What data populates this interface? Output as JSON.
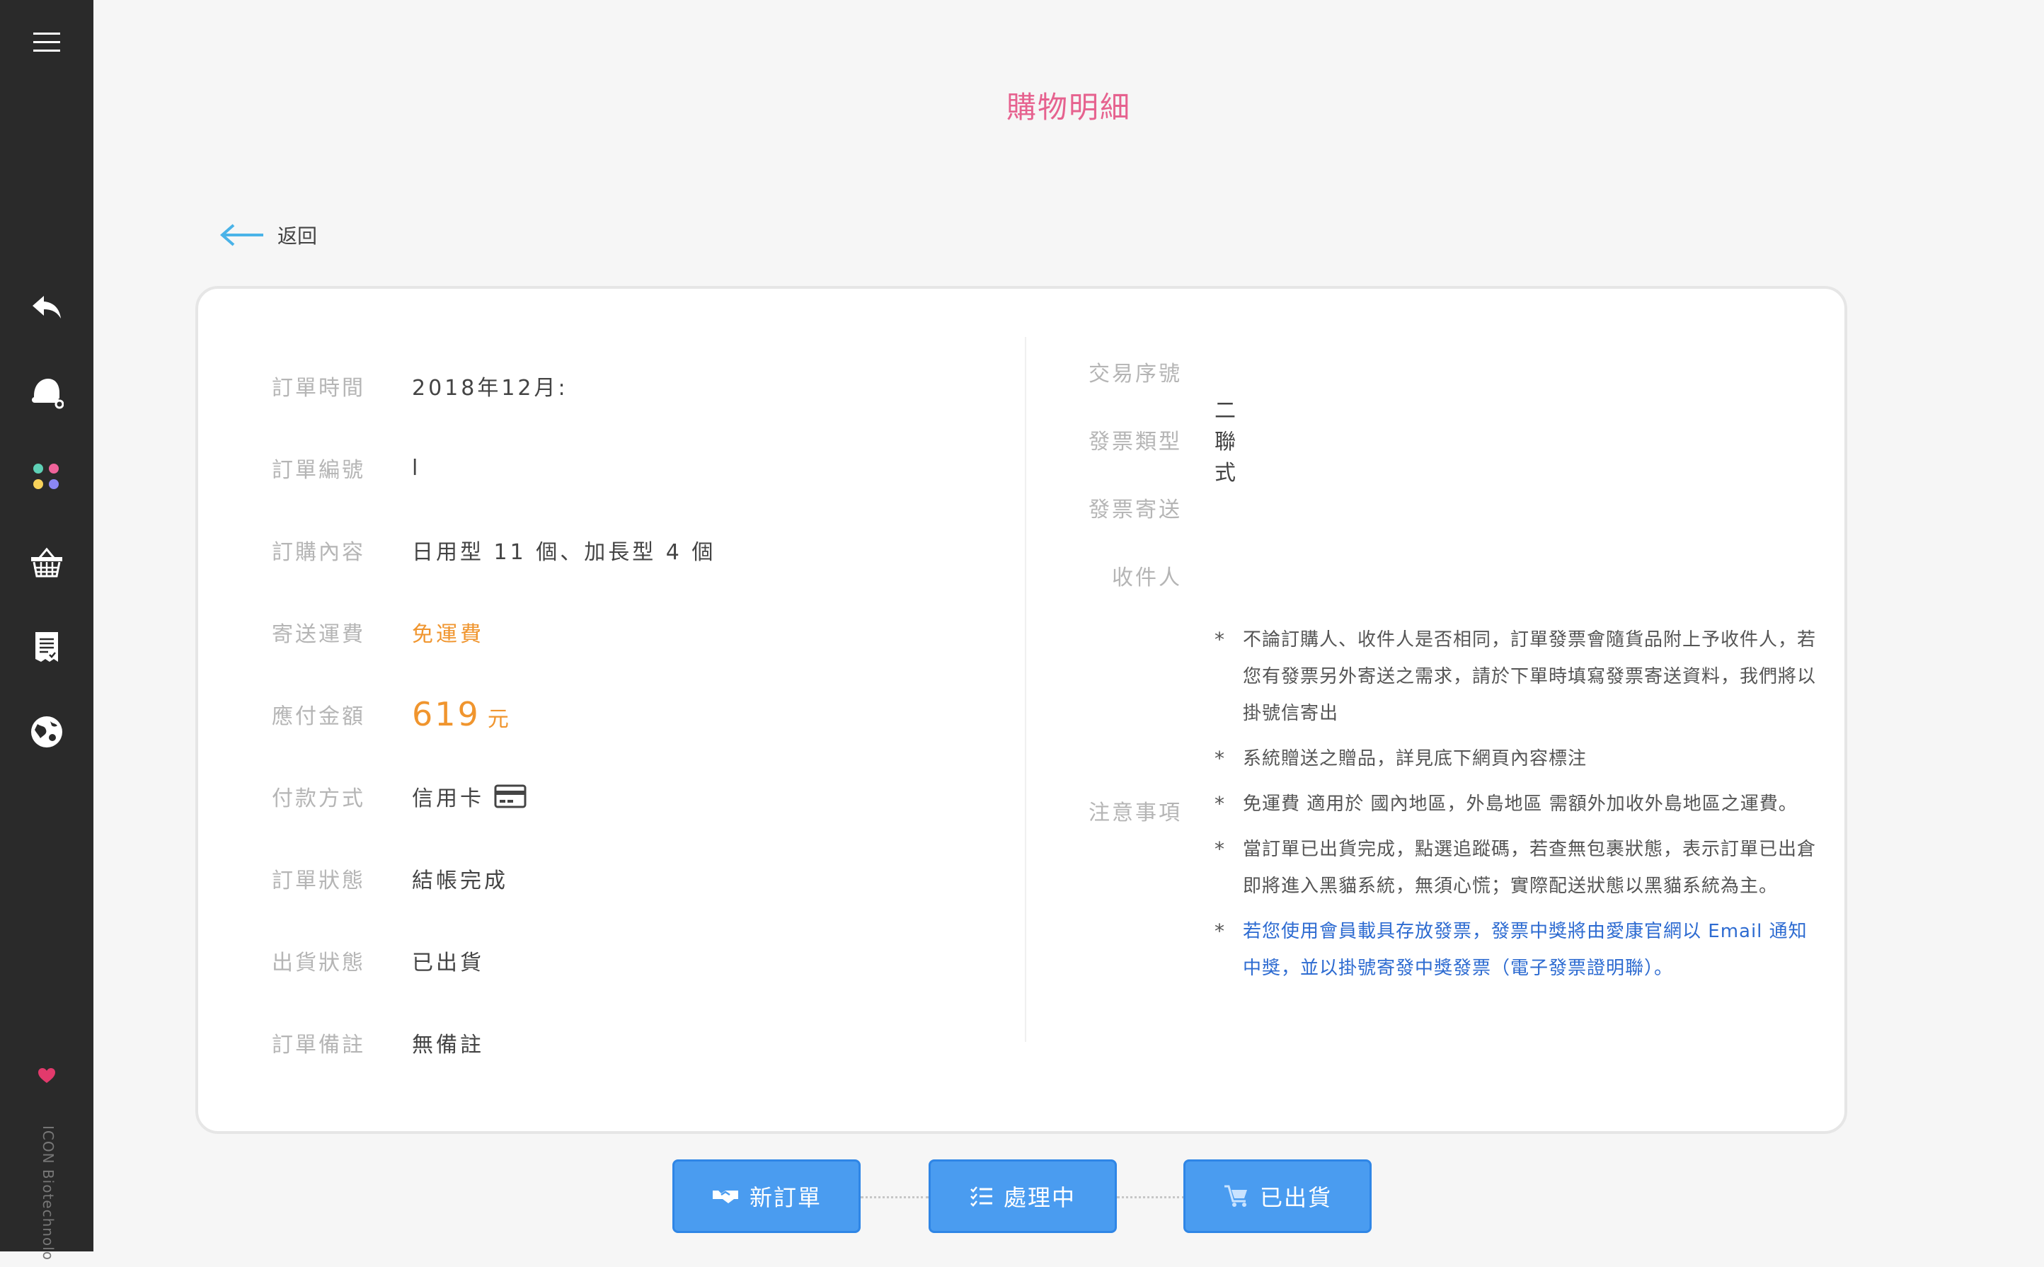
{
  "page": {
    "title": "購物明細",
    "back_label": "返回"
  },
  "sidebar": {
    "menu_icon": "menu-icon",
    "items": [
      {
        "name": "reply",
        "icon": "reply-icon"
      },
      {
        "name": "hat",
        "icon": "santa-hat-icon"
      },
      {
        "name": "apps",
        "icon": "dots-grid-icon"
      },
      {
        "name": "basket",
        "icon": "basket-icon"
      },
      {
        "name": "invoice",
        "icon": "receipt-icon"
      },
      {
        "name": "globe",
        "icon": "globe-logo-icon"
      }
    ],
    "brand_text": "ICON Biotechnolo"
  },
  "order": {
    "time_label": "訂單時間",
    "time_value": "2018年12月:",
    "number_label": "訂單編號",
    "number_value": "l",
    "content_label": "訂購內容",
    "content_value": "日用型 11 個、加長型 4 個",
    "shipping_label": "寄送運費",
    "shipping_value": "免運費",
    "amount_label": "應付金額",
    "amount_value": "619",
    "amount_unit": "元",
    "payment_label": "付款方式",
    "payment_value": "信用卡",
    "status_label": "訂單狀態",
    "status_value": "結帳完成",
    "delivery_label": "出貨狀態",
    "delivery_value": "已出貨",
    "remark_label": "訂單備註",
    "remark_value": "無備註"
  },
  "invoice": {
    "txn_label": "交易序號",
    "txn_value": "",
    "type_label": "發票類型",
    "type_value": "二聯式",
    "send_label": "發票寄送",
    "send_value": "",
    "recipient_label": "收件人",
    "recipient_value": "",
    "notes_label": "注意事項",
    "notes": [
      "不論訂購人、收件人是否相同，訂單發票會隨貨品附上予收件人，若您有發票另外寄送之需求，請於下單時填寫發票寄送資料，我們將以掛號信寄出",
      "系統贈送之贈品，詳見底下網頁內容標注",
      "免運費 適用於 國內地區，外島地區 需額外加收外島地區之運費。",
      "當訂單已出貨完成，點選追蹤碼，若查無包裹狀態，表示訂單已出倉即將進入黑貓系統，無須心慌；實際配送狀態以黑貓系統為主。",
      "若您使用會員載具存放發票，發票中獎將由愛康官網以 Email 通知中獎，並以掛號寄發中獎發票（電子發票證明聯）。"
    ]
  },
  "steps": [
    {
      "label": "新訂單",
      "icon": "handshake-icon"
    },
    {
      "label": "處理中",
      "icon": "checklist-icon"
    },
    {
      "label": "已出貨",
      "icon": "cart-icon"
    }
  ],
  "colors": {
    "accent_pink": "#e6628f",
    "orange": "#f0952e",
    "step_blue": "#4a9cf0",
    "note_blue": "#2d6bd1"
  }
}
